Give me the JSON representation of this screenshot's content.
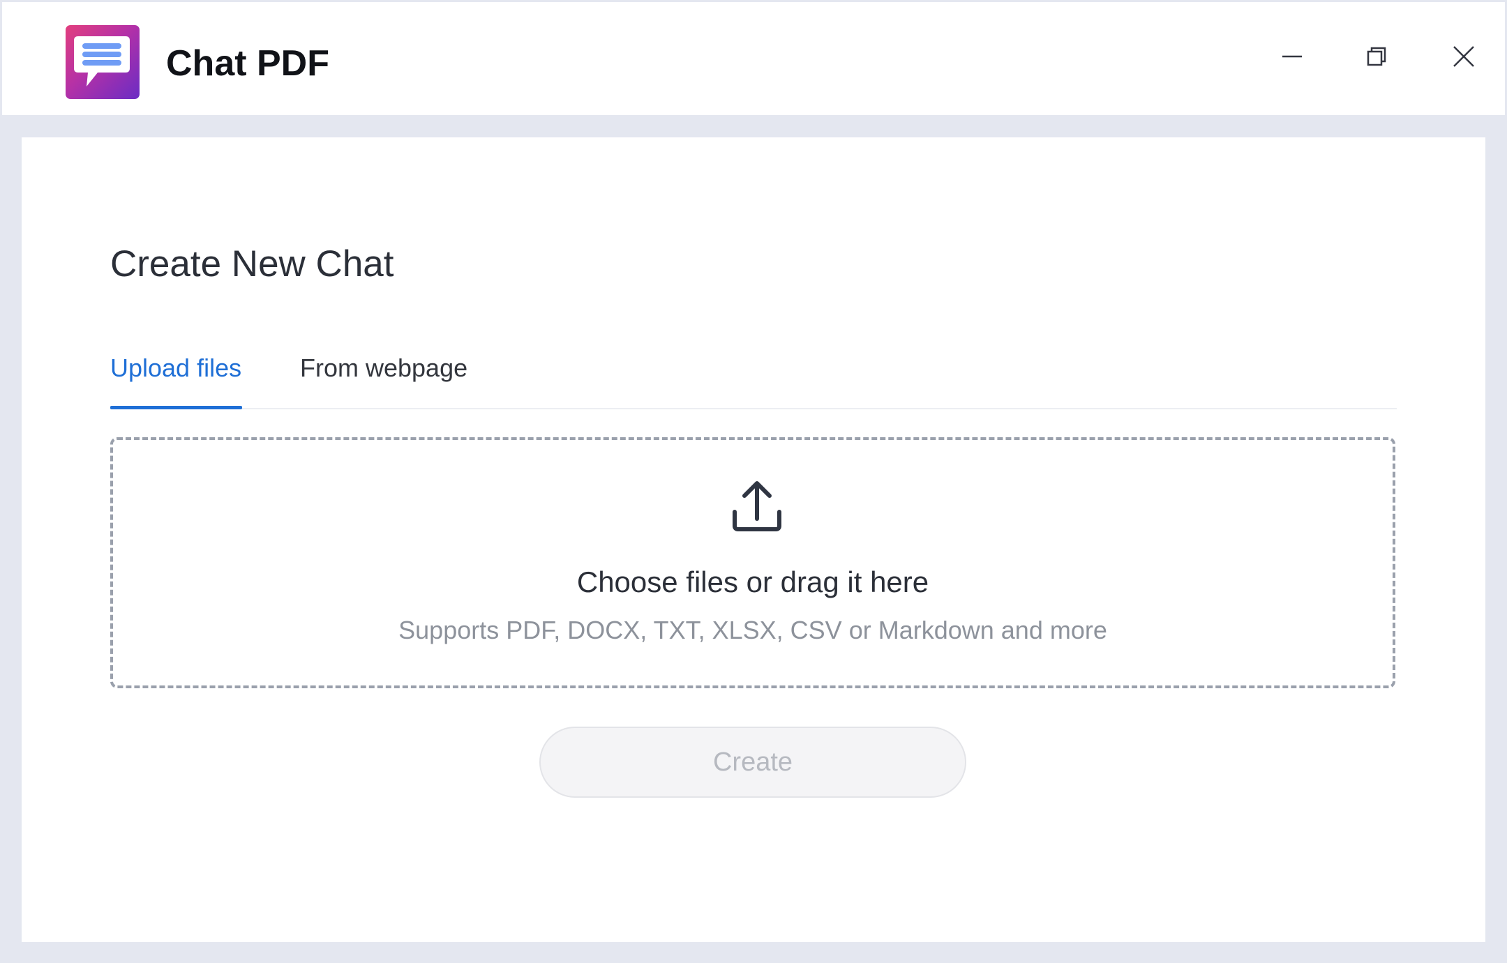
{
  "app": {
    "title": "Chat PDF",
    "logo_icon": "chat-bubble-icon",
    "logo_gradient": [
      "#e23f7e",
      "#6a2cc4"
    ]
  },
  "window_controls": {
    "minimize_icon": "minimize-icon",
    "restore_icon": "restore-icon",
    "close_icon": "close-icon"
  },
  "dialog": {
    "title": "Create New Chat",
    "tabs": [
      {
        "label": "Upload files",
        "active": true
      },
      {
        "label": "From webpage",
        "active": false
      }
    ],
    "dropzone": {
      "icon": "upload-icon",
      "title": "Choose files or drag it here",
      "subtitle": "Supports PDF, DOCX, TXT, XLSX, CSV or Markdown and more"
    },
    "create_label": "Create",
    "create_disabled": true
  },
  "colors": {
    "accent": "#1f6fd6",
    "background": "#e4e7f0",
    "panel": "#ffffff",
    "disabled_text": "#b6b9c0"
  }
}
